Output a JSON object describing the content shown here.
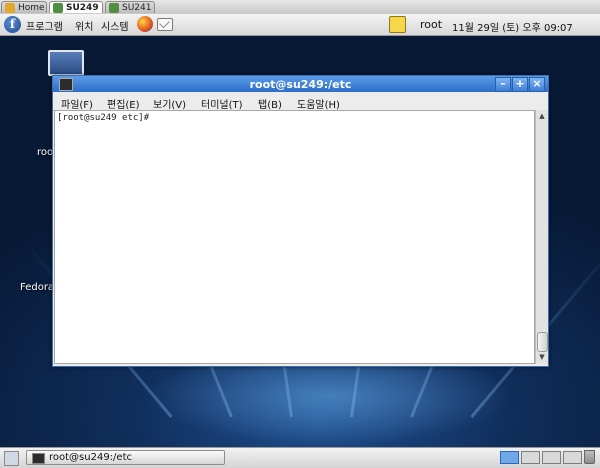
{
  "viewer": {
    "tabs": [
      {
        "label": "Home"
      },
      {
        "label": "SU249"
      },
      {
        "label": "SU241"
      }
    ]
  },
  "panel": {
    "menus": [
      "프로그램",
      "위치",
      "시스템"
    ],
    "user": "root",
    "clock": "11월 29일 (토) 오후 09:07"
  },
  "desktop": {
    "labels": [
      "roo",
      "Fedora"
    ]
  },
  "terminal": {
    "title": "root@su249:/etc",
    "menu": [
      "파일(F)",
      "편집(E)",
      "보기(V)",
      "터미널(T)",
      "탭(B)",
      "도움말(H)"
    ],
    "prompt": "[root@su249 etc]#"
  },
  "taskbar": {
    "task_label": "root@su249:/etc"
  }
}
